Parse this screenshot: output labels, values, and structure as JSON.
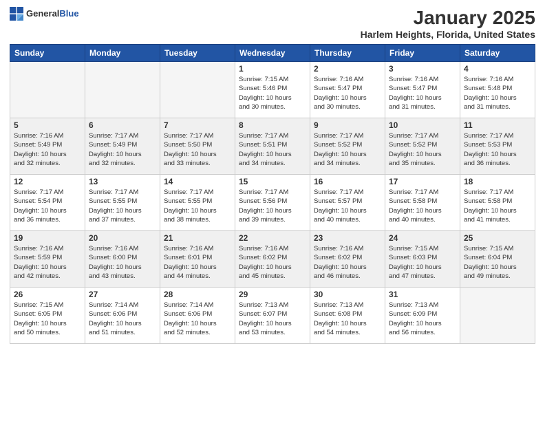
{
  "logo": {
    "general": "General",
    "blue": "Blue"
  },
  "header": {
    "title": "January 2025",
    "subtitle": "Harlem Heights, Florida, United States"
  },
  "weekdays": [
    "Sunday",
    "Monday",
    "Tuesday",
    "Wednesday",
    "Thursday",
    "Friday",
    "Saturday"
  ],
  "weeks": [
    [
      {
        "day": "",
        "info": ""
      },
      {
        "day": "",
        "info": ""
      },
      {
        "day": "",
        "info": ""
      },
      {
        "day": "1",
        "info": "Sunrise: 7:15 AM\nSunset: 5:46 PM\nDaylight: 10 hours\nand 30 minutes."
      },
      {
        "day": "2",
        "info": "Sunrise: 7:16 AM\nSunset: 5:47 PM\nDaylight: 10 hours\nand 30 minutes."
      },
      {
        "day": "3",
        "info": "Sunrise: 7:16 AM\nSunset: 5:47 PM\nDaylight: 10 hours\nand 31 minutes."
      },
      {
        "day": "4",
        "info": "Sunrise: 7:16 AM\nSunset: 5:48 PM\nDaylight: 10 hours\nand 31 minutes."
      }
    ],
    [
      {
        "day": "5",
        "info": "Sunrise: 7:16 AM\nSunset: 5:49 PM\nDaylight: 10 hours\nand 32 minutes."
      },
      {
        "day": "6",
        "info": "Sunrise: 7:17 AM\nSunset: 5:49 PM\nDaylight: 10 hours\nand 32 minutes."
      },
      {
        "day": "7",
        "info": "Sunrise: 7:17 AM\nSunset: 5:50 PM\nDaylight: 10 hours\nand 33 minutes."
      },
      {
        "day": "8",
        "info": "Sunrise: 7:17 AM\nSunset: 5:51 PM\nDaylight: 10 hours\nand 34 minutes."
      },
      {
        "day": "9",
        "info": "Sunrise: 7:17 AM\nSunset: 5:52 PM\nDaylight: 10 hours\nand 34 minutes."
      },
      {
        "day": "10",
        "info": "Sunrise: 7:17 AM\nSunset: 5:52 PM\nDaylight: 10 hours\nand 35 minutes."
      },
      {
        "day": "11",
        "info": "Sunrise: 7:17 AM\nSunset: 5:53 PM\nDaylight: 10 hours\nand 36 minutes."
      }
    ],
    [
      {
        "day": "12",
        "info": "Sunrise: 7:17 AM\nSunset: 5:54 PM\nDaylight: 10 hours\nand 36 minutes."
      },
      {
        "day": "13",
        "info": "Sunrise: 7:17 AM\nSunset: 5:55 PM\nDaylight: 10 hours\nand 37 minutes."
      },
      {
        "day": "14",
        "info": "Sunrise: 7:17 AM\nSunset: 5:55 PM\nDaylight: 10 hours\nand 38 minutes."
      },
      {
        "day": "15",
        "info": "Sunrise: 7:17 AM\nSunset: 5:56 PM\nDaylight: 10 hours\nand 39 minutes."
      },
      {
        "day": "16",
        "info": "Sunrise: 7:17 AM\nSunset: 5:57 PM\nDaylight: 10 hours\nand 40 minutes."
      },
      {
        "day": "17",
        "info": "Sunrise: 7:17 AM\nSunset: 5:58 PM\nDaylight: 10 hours\nand 40 minutes."
      },
      {
        "day": "18",
        "info": "Sunrise: 7:17 AM\nSunset: 5:58 PM\nDaylight: 10 hours\nand 41 minutes."
      }
    ],
    [
      {
        "day": "19",
        "info": "Sunrise: 7:16 AM\nSunset: 5:59 PM\nDaylight: 10 hours\nand 42 minutes."
      },
      {
        "day": "20",
        "info": "Sunrise: 7:16 AM\nSunset: 6:00 PM\nDaylight: 10 hours\nand 43 minutes."
      },
      {
        "day": "21",
        "info": "Sunrise: 7:16 AM\nSunset: 6:01 PM\nDaylight: 10 hours\nand 44 minutes."
      },
      {
        "day": "22",
        "info": "Sunrise: 7:16 AM\nSunset: 6:02 PM\nDaylight: 10 hours\nand 45 minutes."
      },
      {
        "day": "23",
        "info": "Sunrise: 7:16 AM\nSunset: 6:02 PM\nDaylight: 10 hours\nand 46 minutes."
      },
      {
        "day": "24",
        "info": "Sunrise: 7:15 AM\nSunset: 6:03 PM\nDaylight: 10 hours\nand 47 minutes."
      },
      {
        "day": "25",
        "info": "Sunrise: 7:15 AM\nSunset: 6:04 PM\nDaylight: 10 hours\nand 49 minutes."
      }
    ],
    [
      {
        "day": "26",
        "info": "Sunrise: 7:15 AM\nSunset: 6:05 PM\nDaylight: 10 hours\nand 50 minutes."
      },
      {
        "day": "27",
        "info": "Sunrise: 7:14 AM\nSunset: 6:06 PM\nDaylight: 10 hours\nand 51 minutes."
      },
      {
        "day": "28",
        "info": "Sunrise: 7:14 AM\nSunset: 6:06 PM\nDaylight: 10 hours\nand 52 minutes."
      },
      {
        "day": "29",
        "info": "Sunrise: 7:13 AM\nSunset: 6:07 PM\nDaylight: 10 hours\nand 53 minutes."
      },
      {
        "day": "30",
        "info": "Sunrise: 7:13 AM\nSunset: 6:08 PM\nDaylight: 10 hours\nand 54 minutes."
      },
      {
        "day": "31",
        "info": "Sunrise: 7:13 AM\nSunset: 6:09 PM\nDaylight: 10 hours\nand 56 minutes."
      },
      {
        "day": "",
        "info": ""
      }
    ]
  ]
}
